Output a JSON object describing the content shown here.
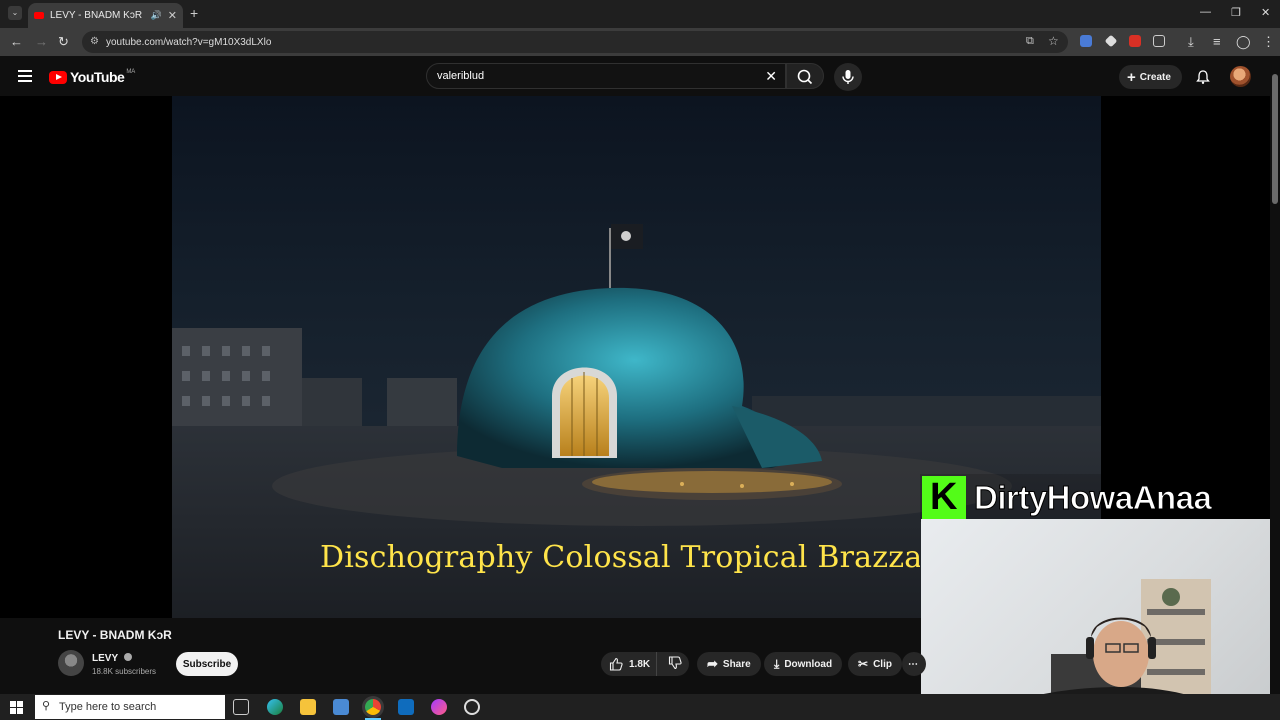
{
  "browser": {
    "tab_title": "LEVY - BNADM KɔR - YouTube",
    "url": "youtube.com/watch?v=gM10X3dLXlo",
    "window_controls": [
      "minimize-icon",
      "restore-icon",
      "close-icon"
    ]
  },
  "youtube": {
    "logo_text": "YouTube",
    "country_code": "MA",
    "search_value": "valeriblud",
    "create_label": "Create"
  },
  "video": {
    "subtitle": "Dischography Colossal Tropical Brazzavil",
    "title": "LEVY - BNADM KɔR",
    "channel_name": "LEVY",
    "subscribers": "18.8K subscribers",
    "subscribe_label": "Subscribe",
    "likes": "1.8K",
    "share_label": "Share",
    "download_label": "Download",
    "clip_label": "Clip"
  },
  "overlay": {
    "brand_letter": "K",
    "streamer_name": "DirtyHowaAnaa",
    "brand_color": "#53fc18"
  },
  "taskbar": {
    "search_placeholder": "Type here to search",
    "pinned": [
      "task-view-icon",
      "edge-icon",
      "file-explorer-icon",
      "store-icon",
      "chrome-icon",
      "outlook-icon",
      "messenger-icon",
      "obs-icon"
    ]
  },
  "colors": {
    "accent": "#ff0000",
    "subtitle": "#ffe44a",
    "background": "#0f0f0f"
  }
}
